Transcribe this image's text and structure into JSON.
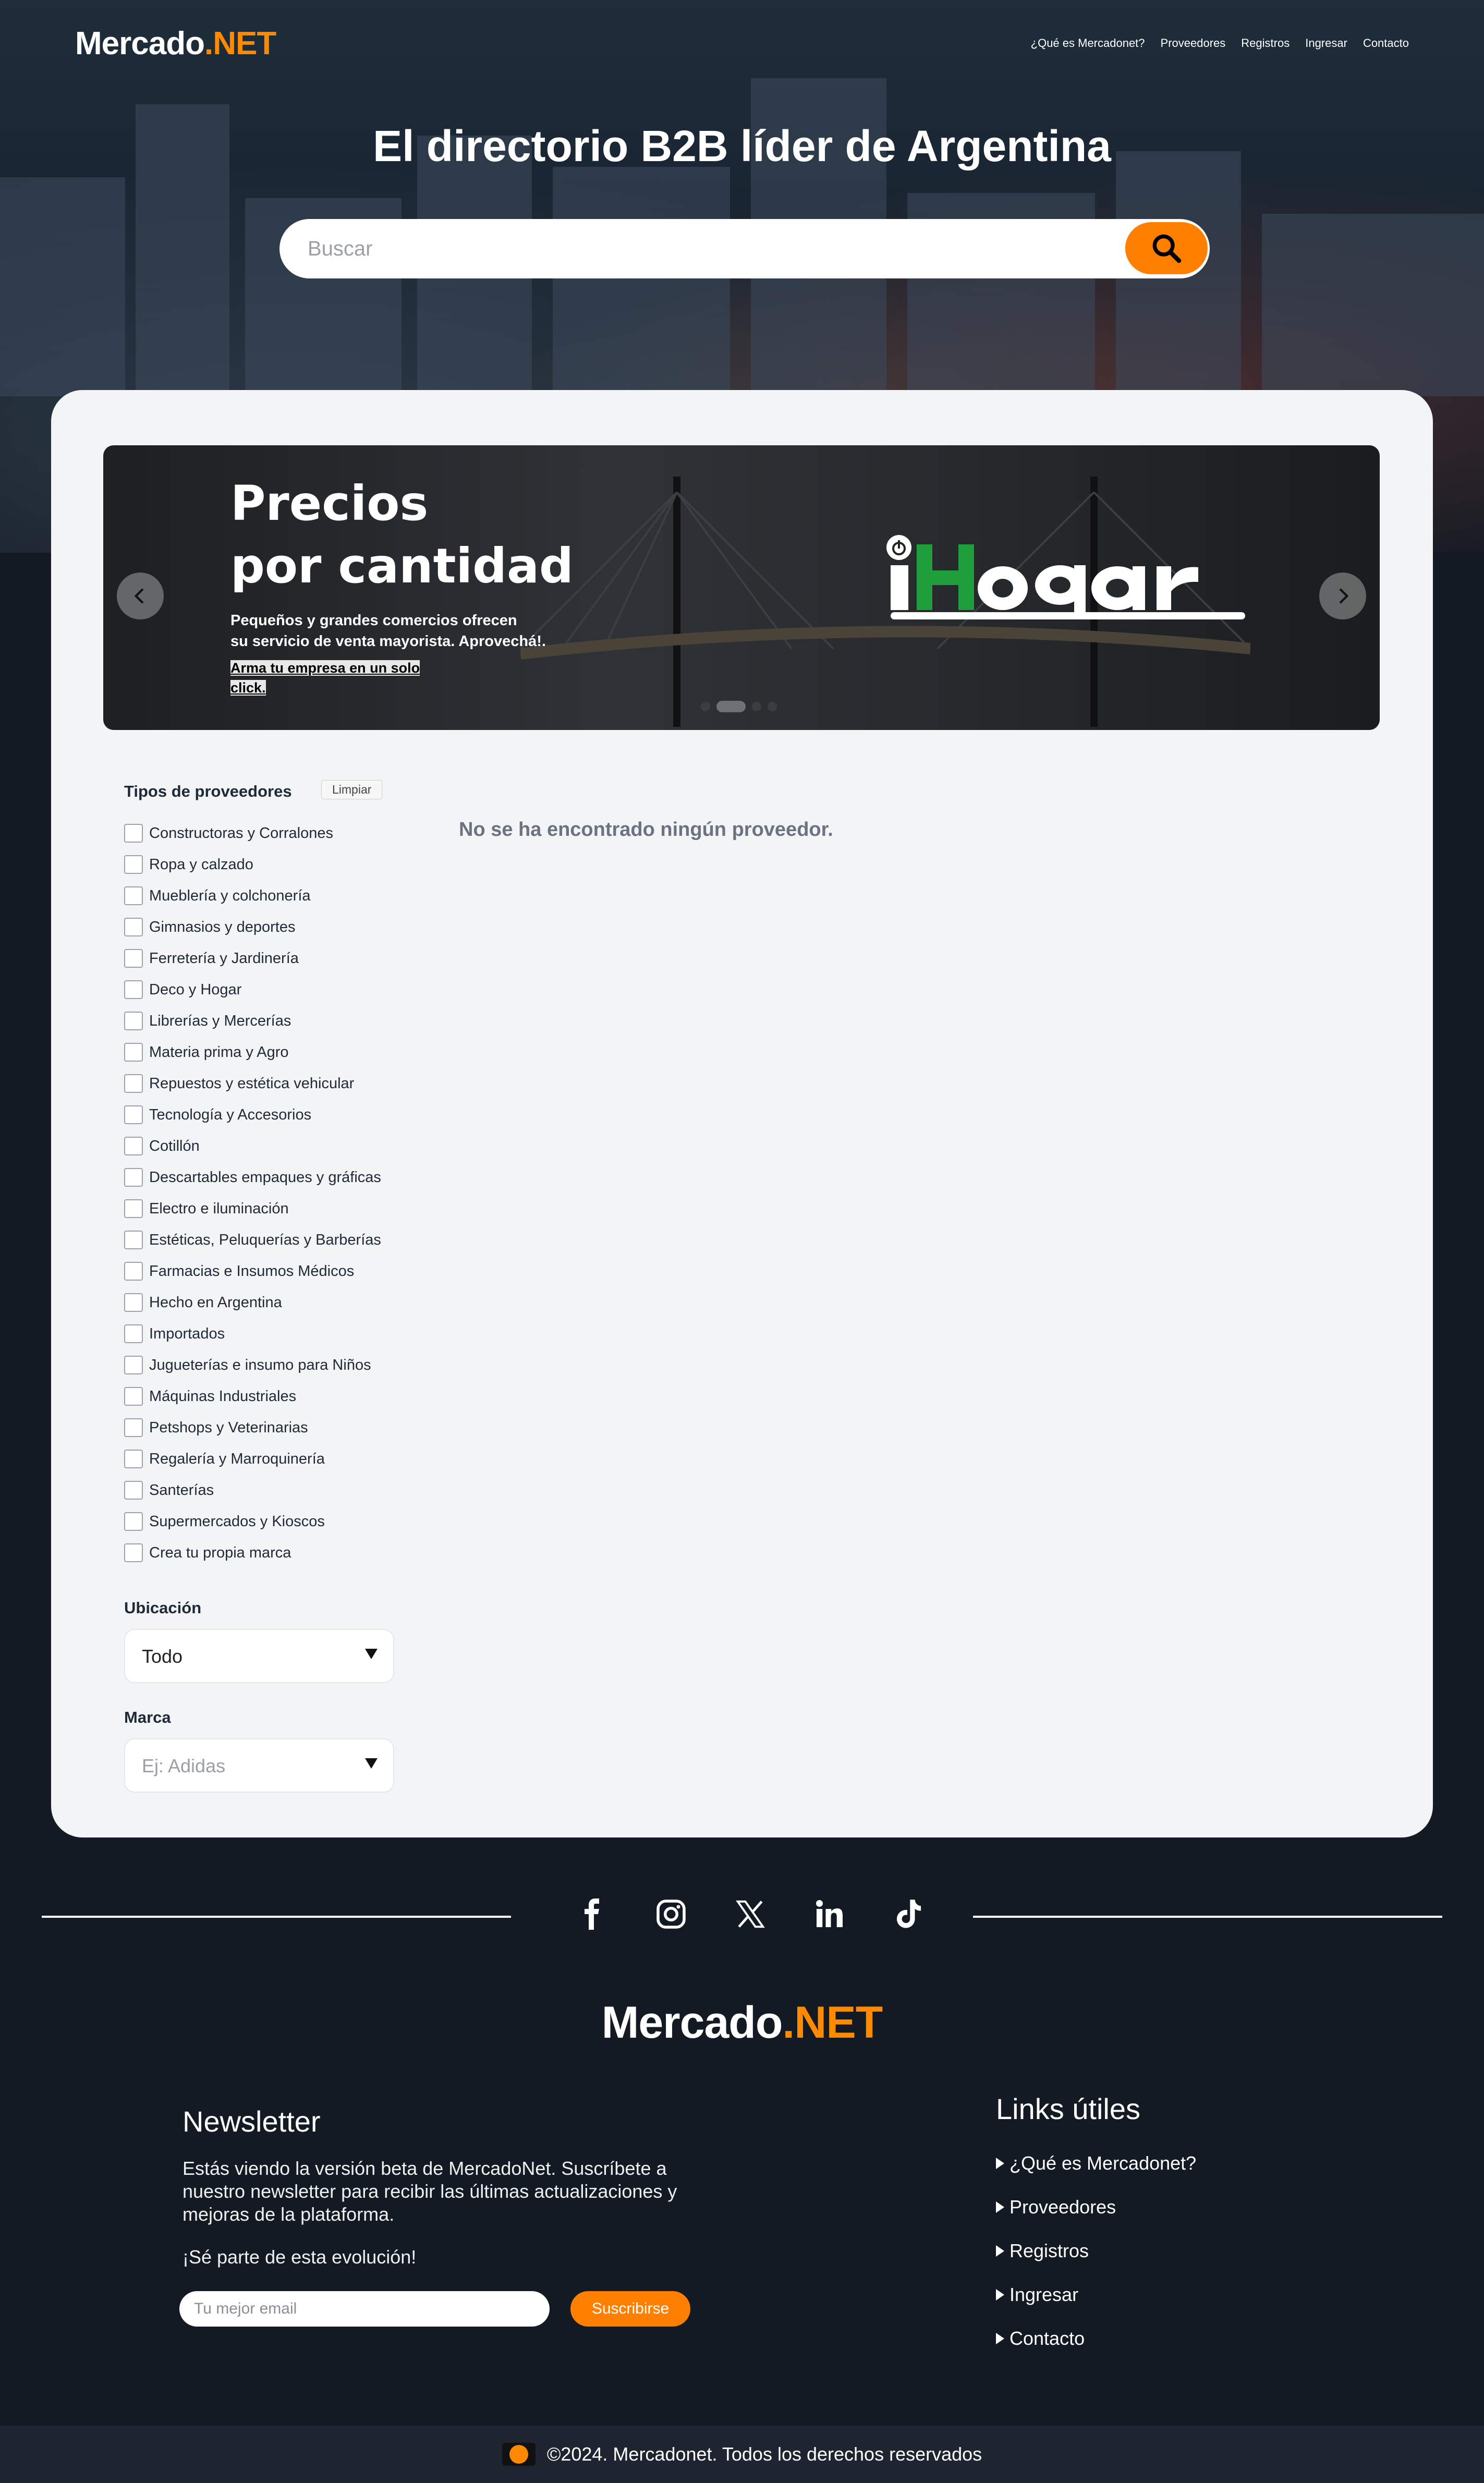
{
  "header": {
    "logo_main": "Mercado",
    "logo_accent": ".NET",
    "nav": [
      "¿Qué es Mercadonet?",
      "Proveedores",
      "Registros",
      "Ingresar",
      "Contacto"
    ]
  },
  "hero": {
    "title": "El directorio B2B líder de Argentina",
    "search_placeholder": "Buscar"
  },
  "banner": {
    "title_line1": "Precios",
    "title_line2": "por cantidad",
    "subtitle_line1": "Pequeños y grandes comercios ofrecen",
    "subtitle_line2": "su servicio de venta mayorista. Aprovechá!.",
    "cta_line1": "Arma tu empresa en un solo",
    "cta_line2": "click.",
    "brand": "iHogar",
    "slides": 4,
    "active_slide": 2
  },
  "filters": {
    "title": "Tipos de proveedores",
    "clear_label": "Limpiar",
    "options": [
      "Constructoras y Corralones",
      "Ropa y calzado",
      "Mueblería y colchonería",
      "Gimnasios y deportes",
      "Ferretería y Jardinería",
      "Deco y Hogar",
      "Librerías y Mercerías",
      "Materia prima y Agro",
      "Repuestos y estética vehicular",
      "Tecnología y Accesorios",
      "Cotillón",
      "Descartables empaques y gráficas",
      "Electro e iluminación",
      "Estéticas, Peluquerías y Barberías",
      "Farmacias e Insumos Médicos",
      "Hecho en Argentina",
      "Importados",
      "Jugueterías e insumo para Niños",
      "Máquinas Industriales",
      "Petshops y Veterinarias",
      "Regalería y Marroquinería",
      "Santerías",
      "Supermercados y Kioscos",
      "Crea tu propia marca"
    ],
    "location_label": "Ubicación",
    "location_value": "Todo",
    "brand_label": "Marca",
    "brand_placeholder": "Ej: Adidas"
  },
  "results": {
    "empty_message": "No se ha encontrado ningún proveedor."
  },
  "footer": {
    "socials": [
      "facebook-icon",
      "instagram-icon",
      "x-icon",
      "linkedin-icon",
      "tiktok-icon"
    ],
    "logo_main": "Mercado",
    "logo_accent": ".NET",
    "newsletter_title": "Newsletter",
    "newsletter_text": "Estás viendo la versión beta de MercadoNet. Suscríbete a nuestro newsletter para recibir las últimas actualizaciones y mejoras de la plataforma.",
    "newsletter_text2": "¡Sé parte de esta evolución!",
    "email_placeholder": "Tu mejor email",
    "subscribe_label": "Suscribirse",
    "links_title": "Links útiles",
    "links": [
      "¿Qué es Mercadonet?",
      "Proveedores",
      "Registros",
      "Ingresar",
      "Contacto"
    ],
    "copyright": "©2024. Mercadonet. Todos los derechos reservados"
  },
  "colors": {
    "accent": "#ff7f00",
    "background": "#131a23",
    "card": "#f3f4f6"
  }
}
